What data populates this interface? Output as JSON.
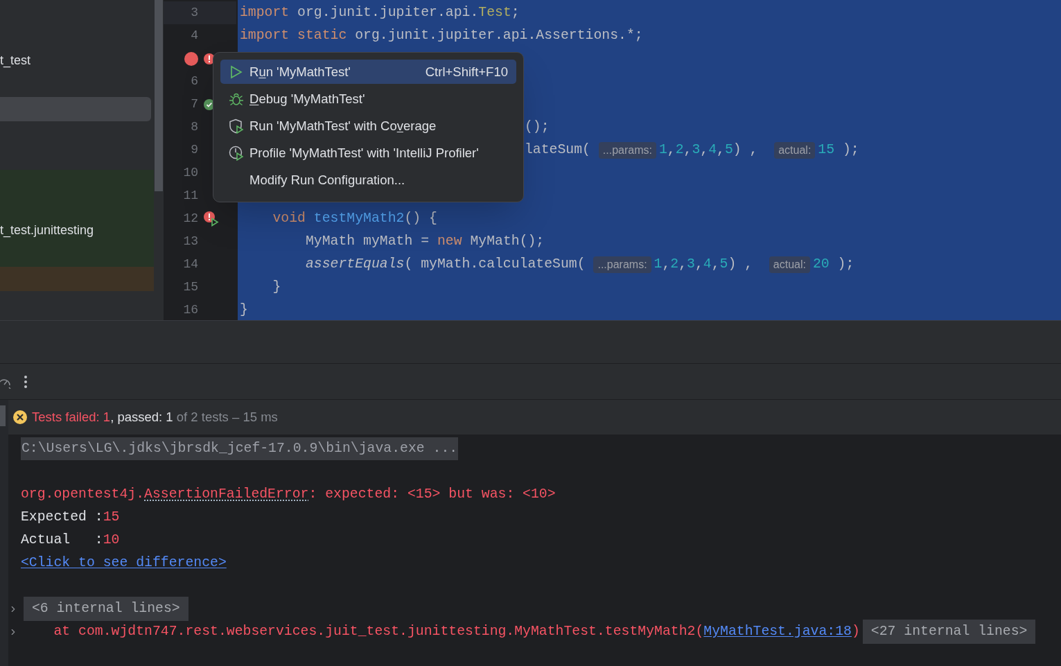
{
  "sidebar": {
    "rows": [
      {
        "kind": "blank"
      },
      {
        "kind": "blank"
      },
      {
        "kind": "item",
        "text": "t_test"
      },
      {
        "kind": "blank"
      },
      {
        "kind": "selected"
      },
      {
        "kind": "blank"
      },
      {
        "kind": "blank"
      },
      {
        "kind": "passed"
      },
      {
        "kind": "passed"
      },
      {
        "kind": "passed",
        "text": "t_test.junittesting"
      },
      {
        "kind": "passed"
      },
      {
        "kind": "modified"
      },
      {
        "kind": "blank"
      }
    ]
  },
  "editor": {
    "lines": [
      {
        "number": "3",
        "current": true,
        "tokens": [
          {
            "kind": "keyword",
            "text": "import"
          },
          {
            "kind": "plain",
            "text": " org.junit.jupiter.api."
          },
          {
            "kind": "annotation",
            "text": "Test"
          },
          {
            "kind": "plain",
            "text": ";"
          }
        ]
      },
      {
        "number": "4",
        "current": false,
        "tokens": [
          {
            "kind": "keyword",
            "text": "import static"
          },
          {
            "kind": "plain",
            "text": " org.junit.jupiter.api.Assertions.*;"
          }
        ]
      },
      {
        "current": false,
        "markers": [
          {
            "kind": "breakpoint"
          },
          {
            "kind": "error"
          }
        ]
      },
      {
        "number": "6",
        "current": false
      },
      {
        "number": "7",
        "current": false,
        "markers": [
          {
            "kind": "passed"
          }
        ]
      },
      {
        "number": "8",
        "current": false,
        "partly_covered": true,
        "tokens": [
          {
            "kind": "plain",
            "text": "();"
          }
        ]
      },
      {
        "number": "9",
        "current": false,
        "partly_covered": true,
        "tokens": [
          {
            "kind": "plain",
            "text": "lateSum( "
          },
          {
            "kind": "hint",
            "text": "...params:"
          },
          {
            "kind": "number",
            "text": "1"
          },
          {
            "kind": "plain",
            "text": ","
          },
          {
            "kind": "number",
            "text": "2"
          },
          {
            "kind": "plain",
            "text": ","
          },
          {
            "kind": "number",
            "text": "3"
          },
          {
            "kind": "plain",
            "text": ","
          },
          {
            "kind": "number",
            "text": "4"
          },
          {
            "kind": "plain",
            "text": ","
          },
          {
            "kind": "number",
            "text": "5"
          },
          {
            "kind": "plain",
            "text": ") ,  "
          },
          {
            "kind": "hint",
            "text": "actual:"
          },
          {
            "kind": "number",
            "text": "15"
          },
          {
            "kind": "plain",
            "text": " );"
          }
        ]
      },
      {
        "number": "10",
        "current": false
      },
      {
        "number": "11",
        "current": false
      },
      {
        "number": "12",
        "current": false,
        "markers": [
          {
            "kind": "error-run"
          }
        ],
        "tokens": [
          {
            "kind": "keyword",
            "text": "    void"
          },
          {
            "kind": "method",
            "text": " testMyMath2"
          },
          {
            "kind": "plain",
            "text": "() {"
          }
        ]
      },
      {
        "number": "13",
        "current": false,
        "tokens": [
          {
            "kind": "plain",
            "text": "        MyMath myMath = "
          },
          {
            "kind": "keyword",
            "text": "new"
          },
          {
            "kind": "plain",
            "text": " MyMath();"
          }
        ]
      },
      {
        "number": "14",
        "current": false,
        "tokens": [
          {
            "kind": "italic",
            "text": "        assertEquals"
          },
          {
            "kind": "plain",
            "text": "( myMath.calculateSum( "
          },
          {
            "kind": "hint",
            "text": "...params:"
          },
          {
            "kind": "number",
            "text": "1"
          },
          {
            "kind": "plain",
            "text": ","
          },
          {
            "kind": "number",
            "text": "2"
          },
          {
            "kind": "plain",
            "text": ","
          },
          {
            "kind": "number",
            "text": "3"
          },
          {
            "kind": "plain",
            "text": ","
          },
          {
            "kind": "number",
            "text": "4"
          },
          {
            "kind": "plain",
            "text": ","
          },
          {
            "kind": "number",
            "text": "5"
          },
          {
            "kind": "plain",
            "text": ") ,  "
          },
          {
            "kind": "hint",
            "text": "actual:"
          },
          {
            "kind": "number",
            "text": "20"
          },
          {
            "kind": "plain",
            "text": " );"
          }
        ]
      },
      {
        "number": "15",
        "current": false,
        "tokens": [
          {
            "kind": "plain",
            "text": "    }"
          }
        ]
      },
      {
        "number": "16",
        "current": false,
        "tokens": [
          {
            "kind": "plain",
            "text": "}"
          }
        ]
      }
    ]
  },
  "context_menu": {
    "items": [
      {
        "kind": "run",
        "before": "R",
        "mnemonic": "u",
        "after": "n 'MyMathTest'",
        "shortcut": "Ctrl+Shift+F10",
        "selected": true
      },
      {
        "kind": "debug",
        "mnemonic": "D",
        "after": "ebug 'MyMathTest'",
        "selected": false
      },
      {
        "kind": "coverage",
        "before": "Run 'MyMathTest' with Co",
        "mnemonic": "v",
        "after": "erage",
        "selected": false
      },
      {
        "kind": "profile",
        "before": "Profile 'MyMathTest' with 'IntelliJ Profiler'",
        "selected": false
      },
      {
        "kind": "plain",
        "before": "Modify Run Configuration...",
        "selected": false
      }
    ]
  },
  "test_summary": [
    {
      "kind": "failed",
      "text": "Tests failed: "
    },
    {
      "kind": "failed",
      "text": "1"
    },
    {
      "kind": "plain",
      "text": ", passed: "
    },
    {
      "kind": "plain",
      "text": "1"
    },
    {
      "kind": "muted",
      "text": " of 2 tests – 15 ms"
    }
  ],
  "console": {
    "lines": [
      {
        "expandable": false,
        "tokens": [
          {
            "kind": "command",
            "text": "C:\\Users\\LG\\.jdks\\jbrsdk_jcef-17.0.9\\bin\\java.exe ..."
          }
        ]
      },
      {
        "expandable": false
      },
      {
        "expandable": false,
        "tokens": [
          {
            "kind": "error",
            "text": "org.opentest4j."
          },
          {
            "kind": "error-link",
            "text": "AssertionFailedError"
          },
          {
            "kind": "error",
            "text": ": expected: <15> but was: <10>"
          }
        ]
      },
      {
        "expandable": false,
        "tokens": [
          {
            "kind": "plain",
            "text": "Expected :"
          },
          {
            "kind": "error",
            "text": "15"
          }
        ]
      },
      {
        "expandable": false,
        "tokens": [
          {
            "kind": "plain",
            "text": "Actual   :"
          },
          {
            "kind": "error",
            "text": "10"
          }
        ]
      },
      {
        "expandable": false,
        "tokens": [
          {
            "kind": "link",
            "text": "<Click to see difference>"
          }
        ]
      },
      {
        "expandable": false
      },
      {
        "expandable": true,
        "tokens": [
          {
            "kind": "folded",
            "text": "<6 internal lines>"
          }
        ]
      },
      {
        "expandable": true,
        "tokens": [
          {
            "kind": "error",
            "text": "    at com.wjdtn747.rest.webservices.juit_test.junittesting.MyMathTest.testMyMath2("
          },
          {
            "kind": "link",
            "text": "MyMathTest.java:18"
          },
          {
            "kind": "error",
            "text": ")"
          },
          {
            "kind": "folded",
            "text": "<27 internal lines>"
          }
        ]
      }
    ]
  }
}
